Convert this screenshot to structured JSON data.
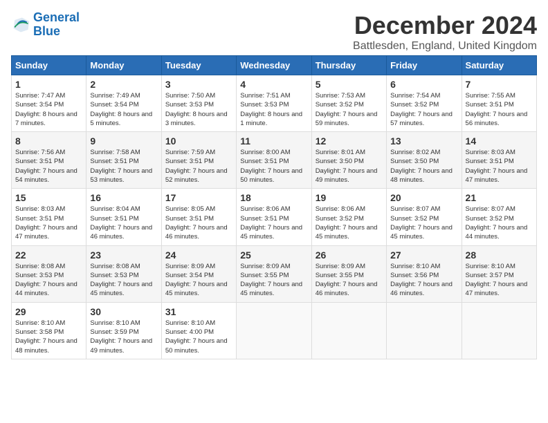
{
  "header": {
    "logo_line1": "General",
    "logo_line2": "Blue",
    "month_title": "December 2024",
    "subtitle": "Battlesden, England, United Kingdom"
  },
  "weekdays": [
    "Sunday",
    "Monday",
    "Tuesday",
    "Wednesday",
    "Thursday",
    "Friday",
    "Saturday"
  ],
  "weeks": [
    [
      {
        "day": "1",
        "sunrise": "Sunrise: 7:47 AM",
        "sunset": "Sunset: 3:54 PM",
        "daylight": "Daylight: 8 hours and 7 minutes."
      },
      {
        "day": "2",
        "sunrise": "Sunrise: 7:49 AM",
        "sunset": "Sunset: 3:54 PM",
        "daylight": "Daylight: 8 hours and 5 minutes."
      },
      {
        "day": "3",
        "sunrise": "Sunrise: 7:50 AM",
        "sunset": "Sunset: 3:53 PM",
        "daylight": "Daylight: 8 hours and 3 minutes."
      },
      {
        "day": "4",
        "sunrise": "Sunrise: 7:51 AM",
        "sunset": "Sunset: 3:53 PM",
        "daylight": "Daylight: 8 hours and 1 minute."
      },
      {
        "day": "5",
        "sunrise": "Sunrise: 7:53 AM",
        "sunset": "Sunset: 3:52 PM",
        "daylight": "Daylight: 7 hours and 59 minutes."
      },
      {
        "day": "6",
        "sunrise": "Sunrise: 7:54 AM",
        "sunset": "Sunset: 3:52 PM",
        "daylight": "Daylight: 7 hours and 57 minutes."
      },
      {
        "day": "7",
        "sunrise": "Sunrise: 7:55 AM",
        "sunset": "Sunset: 3:51 PM",
        "daylight": "Daylight: 7 hours and 56 minutes."
      }
    ],
    [
      {
        "day": "8",
        "sunrise": "Sunrise: 7:56 AM",
        "sunset": "Sunset: 3:51 PM",
        "daylight": "Daylight: 7 hours and 54 minutes."
      },
      {
        "day": "9",
        "sunrise": "Sunrise: 7:58 AM",
        "sunset": "Sunset: 3:51 PM",
        "daylight": "Daylight: 7 hours and 53 minutes."
      },
      {
        "day": "10",
        "sunrise": "Sunrise: 7:59 AM",
        "sunset": "Sunset: 3:51 PM",
        "daylight": "Daylight: 7 hours and 52 minutes."
      },
      {
        "day": "11",
        "sunrise": "Sunrise: 8:00 AM",
        "sunset": "Sunset: 3:51 PM",
        "daylight": "Daylight: 7 hours and 50 minutes."
      },
      {
        "day": "12",
        "sunrise": "Sunrise: 8:01 AM",
        "sunset": "Sunset: 3:50 PM",
        "daylight": "Daylight: 7 hours and 49 minutes."
      },
      {
        "day": "13",
        "sunrise": "Sunrise: 8:02 AM",
        "sunset": "Sunset: 3:50 PM",
        "daylight": "Daylight: 7 hours and 48 minutes."
      },
      {
        "day": "14",
        "sunrise": "Sunrise: 8:03 AM",
        "sunset": "Sunset: 3:51 PM",
        "daylight": "Daylight: 7 hours and 47 minutes."
      }
    ],
    [
      {
        "day": "15",
        "sunrise": "Sunrise: 8:03 AM",
        "sunset": "Sunset: 3:51 PM",
        "daylight": "Daylight: 7 hours and 47 minutes."
      },
      {
        "day": "16",
        "sunrise": "Sunrise: 8:04 AM",
        "sunset": "Sunset: 3:51 PM",
        "daylight": "Daylight: 7 hours and 46 minutes."
      },
      {
        "day": "17",
        "sunrise": "Sunrise: 8:05 AM",
        "sunset": "Sunset: 3:51 PM",
        "daylight": "Daylight: 7 hours and 46 minutes."
      },
      {
        "day": "18",
        "sunrise": "Sunrise: 8:06 AM",
        "sunset": "Sunset: 3:51 PM",
        "daylight": "Daylight: 7 hours and 45 minutes."
      },
      {
        "day": "19",
        "sunrise": "Sunrise: 8:06 AM",
        "sunset": "Sunset: 3:52 PM",
        "daylight": "Daylight: 7 hours and 45 minutes."
      },
      {
        "day": "20",
        "sunrise": "Sunrise: 8:07 AM",
        "sunset": "Sunset: 3:52 PM",
        "daylight": "Daylight: 7 hours and 45 minutes."
      },
      {
        "day": "21",
        "sunrise": "Sunrise: 8:07 AM",
        "sunset": "Sunset: 3:52 PM",
        "daylight": "Daylight: 7 hours and 44 minutes."
      }
    ],
    [
      {
        "day": "22",
        "sunrise": "Sunrise: 8:08 AM",
        "sunset": "Sunset: 3:53 PM",
        "daylight": "Daylight: 7 hours and 44 minutes."
      },
      {
        "day": "23",
        "sunrise": "Sunrise: 8:08 AM",
        "sunset": "Sunset: 3:53 PM",
        "daylight": "Daylight: 7 hours and 45 minutes."
      },
      {
        "day": "24",
        "sunrise": "Sunrise: 8:09 AM",
        "sunset": "Sunset: 3:54 PM",
        "daylight": "Daylight: 7 hours and 45 minutes."
      },
      {
        "day": "25",
        "sunrise": "Sunrise: 8:09 AM",
        "sunset": "Sunset: 3:55 PM",
        "daylight": "Daylight: 7 hours and 45 minutes."
      },
      {
        "day": "26",
        "sunrise": "Sunrise: 8:09 AM",
        "sunset": "Sunset: 3:55 PM",
        "daylight": "Daylight: 7 hours and 46 minutes."
      },
      {
        "day": "27",
        "sunrise": "Sunrise: 8:10 AM",
        "sunset": "Sunset: 3:56 PM",
        "daylight": "Daylight: 7 hours and 46 minutes."
      },
      {
        "day": "28",
        "sunrise": "Sunrise: 8:10 AM",
        "sunset": "Sunset: 3:57 PM",
        "daylight": "Daylight: 7 hours and 47 minutes."
      }
    ],
    [
      {
        "day": "29",
        "sunrise": "Sunrise: 8:10 AM",
        "sunset": "Sunset: 3:58 PM",
        "daylight": "Daylight: 7 hours and 48 minutes."
      },
      {
        "day": "30",
        "sunrise": "Sunrise: 8:10 AM",
        "sunset": "Sunset: 3:59 PM",
        "daylight": "Daylight: 7 hours and 49 minutes."
      },
      {
        "day": "31",
        "sunrise": "Sunrise: 8:10 AM",
        "sunset": "Sunset: 4:00 PM",
        "daylight": "Daylight: 7 hours and 50 minutes."
      },
      null,
      null,
      null,
      null
    ]
  ]
}
